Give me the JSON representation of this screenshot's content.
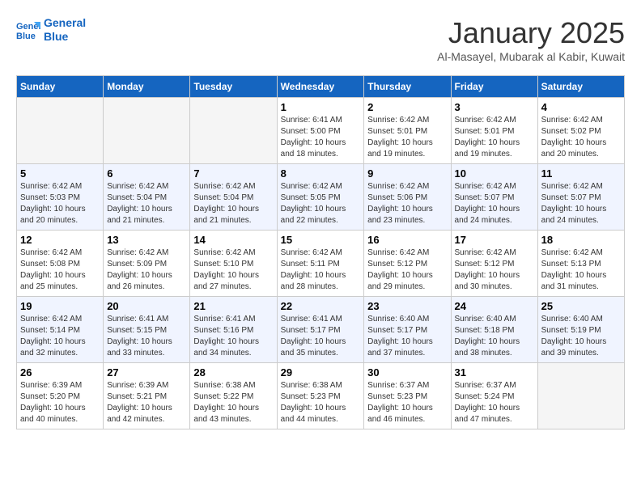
{
  "logo": {
    "line1": "General",
    "line2": "Blue"
  },
  "header": {
    "month": "January 2025",
    "location": "Al-Masayel, Mubarak al Kabir, Kuwait"
  },
  "weekdays": [
    "Sunday",
    "Monday",
    "Tuesday",
    "Wednesday",
    "Thursday",
    "Friday",
    "Saturday"
  ],
  "weeks": [
    [
      {
        "num": "",
        "info": ""
      },
      {
        "num": "",
        "info": ""
      },
      {
        "num": "",
        "info": ""
      },
      {
        "num": "1",
        "info": "Sunrise: 6:41 AM\nSunset: 5:00 PM\nDaylight: 10 hours\nand 18 minutes."
      },
      {
        "num": "2",
        "info": "Sunrise: 6:42 AM\nSunset: 5:01 PM\nDaylight: 10 hours\nand 19 minutes."
      },
      {
        "num": "3",
        "info": "Sunrise: 6:42 AM\nSunset: 5:01 PM\nDaylight: 10 hours\nand 19 minutes."
      },
      {
        "num": "4",
        "info": "Sunrise: 6:42 AM\nSunset: 5:02 PM\nDaylight: 10 hours\nand 20 minutes."
      }
    ],
    [
      {
        "num": "5",
        "info": "Sunrise: 6:42 AM\nSunset: 5:03 PM\nDaylight: 10 hours\nand 20 minutes."
      },
      {
        "num": "6",
        "info": "Sunrise: 6:42 AM\nSunset: 5:04 PM\nDaylight: 10 hours\nand 21 minutes."
      },
      {
        "num": "7",
        "info": "Sunrise: 6:42 AM\nSunset: 5:04 PM\nDaylight: 10 hours\nand 21 minutes."
      },
      {
        "num": "8",
        "info": "Sunrise: 6:42 AM\nSunset: 5:05 PM\nDaylight: 10 hours\nand 22 minutes."
      },
      {
        "num": "9",
        "info": "Sunrise: 6:42 AM\nSunset: 5:06 PM\nDaylight: 10 hours\nand 23 minutes."
      },
      {
        "num": "10",
        "info": "Sunrise: 6:42 AM\nSunset: 5:07 PM\nDaylight: 10 hours\nand 24 minutes."
      },
      {
        "num": "11",
        "info": "Sunrise: 6:42 AM\nSunset: 5:07 PM\nDaylight: 10 hours\nand 24 minutes."
      }
    ],
    [
      {
        "num": "12",
        "info": "Sunrise: 6:42 AM\nSunset: 5:08 PM\nDaylight: 10 hours\nand 25 minutes."
      },
      {
        "num": "13",
        "info": "Sunrise: 6:42 AM\nSunset: 5:09 PM\nDaylight: 10 hours\nand 26 minutes."
      },
      {
        "num": "14",
        "info": "Sunrise: 6:42 AM\nSunset: 5:10 PM\nDaylight: 10 hours\nand 27 minutes."
      },
      {
        "num": "15",
        "info": "Sunrise: 6:42 AM\nSunset: 5:11 PM\nDaylight: 10 hours\nand 28 minutes."
      },
      {
        "num": "16",
        "info": "Sunrise: 6:42 AM\nSunset: 5:12 PM\nDaylight: 10 hours\nand 29 minutes."
      },
      {
        "num": "17",
        "info": "Sunrise: 6:42 AM\nSunset: 5:12 PM\nDaylight: 10 hours\nand 30 minutes."
      },
      {
        "num": "18",
        "info": "Sunrise: 6:42 AM\nSunset: 5:13 PM\nDaylight: 10 hours\nand 31 minutes."
      }
    ],
    [
      {
        "num": "19",
        "info": "Sunrise: 6:42 AM\nSunset: 5:14 PM\nDaylight: 10 hours\nand 32 minutes."
      },
      {
        "num": "20",
        "info": "Sunrise: 6:41 AM\nSunset: 5:15 PM\nDaylight: 10 hours\nand 33 minutes."
      },
      {
        "num": "21",
        "info": "Sunrise: 6:41 AM\nSunset: 5:16 PM\nDaylight: 10 hours\nand 34 minutes."
      },
      {
        "num": "22",
        "info": "Sunrise: 6:41 AM\nSunset: 5:17 PM\nDaylight: 10 hours\nand 35 minutes."
      },
      {
        "num": "23",
        "info": "Sunrise: 6:40 AM\nSunset: 5:17 PM\nDaylight: 10 hours\nand 37 minutes."
      },
      {
        "num": "24",
        "info": "Sunrise: 6:40 AM\nSunset: 5:18 PM\nDaylight: 10 hours\nand 38 minutes."
      },
      {
        "num": "25",
        "info": "Sunrise: 6:40 AM\nSunset: 5:19 PM\nDaylight: 10 hours\nand 39 minutes."
      }
    ],
    [
      {
        "num": "26",
        "info": "Sunrise: 6:39 AM\nSunset: 5:20 PM\nDaylight: 10 hours\nand 40 minutes."
      },
      {
        "num": "27",
        "info": "Sunrise: 6:39 AM\nSunset: 5:21 PM\nDaylight: 10 hours\nand 42 minutes."
      },
      {
        "num": "28",
        "info": "Sunrise: 6:38 AM\nSunset: 5:22 PM\nDaylight: 10 hours\nand 43 minutes."
      },
      {
        "num": "29",
        "info": "Sunrise: 6:38 AM\nSunset: 5:23 PM\nDaylight: 10 hours\nand 44 minutes."
      },
      {
        "num": "30",
        "info": "Sunrise: 6:37 AM\nSunset: 5:23 PM\nDaylight: 10 hours\nand 46 minutes."
      },
      {
        "num": "31",
        "info": "Sunrise: 6:37 AM\nSunset: 5:24 PM\nDaylight: 10 hours\nand 47 minutes."
      },
      {
        "num": "",
        "info": ""
      }
    ]
  ]
}
